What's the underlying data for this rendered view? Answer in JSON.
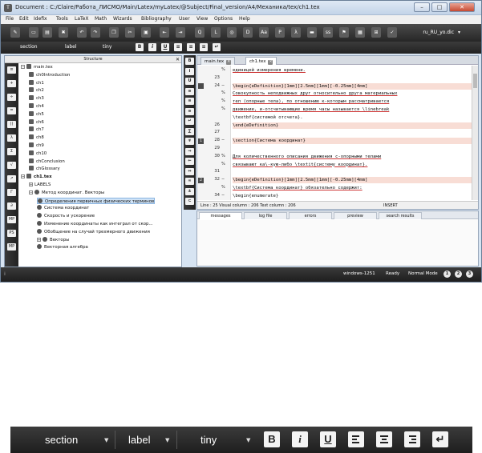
{
  "window": {
    "title": "Document : C:/Claire/Работа_ЛИСМО/Main/Latex/myLatex/@Subject/Final_version/A4/Механика/tex/ch1.tex",
    "min_label": "–",
    "max_label": "□",
    "close_label": "✕"
  },
  "menu": [
    "File",
    "Edit",
    "Idefix",
    "Tools",
    "LaTeX",
    "Math",
    "Wizards",
    "Bibliography",
    "User",
    "View",
    "Options",
    "Help"
  ],
  "toolbar": {
    "dictionary": "ru_RU_yo.dic",
    "icons": [
      "new-file-icon",
      "save-icon",
      "print-icon",
      "close-file-icon",
      "undo-icon",
      "redo-icon",
      "copy-icon",
      "cut-icon",
      "paste-icon",
      "back-icon",
      "forward-icon",
      "find-icon",
      "compile-icon",
      "view-icon",
      "dvi-icon",
      "font-icon",
      "pdf-icon",
      "lambda-icon",
      "ps-icon",
      "table-icon",
      "check-icon"
    ]
  },
  "format_toolbar": {
    "section": "section",
    "label": "label",
    "size": "tiny",
    "bold": "B",
    "italic": "i",
    "underline": "U",
    "align_left": "",
    "align_center": "",
    "align_right": "",
    "newline": "↵"
  },
  "structure": {
    "header": "Structure",
    "close": "✕",
    "tree": [
      {
        "label": "main.tex",
        "level": 0,
        "icon": "doc",
        "expander": "−"
      },
      {
        "label": "ch0Introduction",
        "level": 1,
        "icon": "doc"
      },
      {
        "label": "ch1",
        "level": 1,
        "icon": "doc"
      },
      {
        "label": "ch2",
        "level": 1,
        "icon": "doc"
      },
      {
        "label": "ch3",
        "level": 1,
        "icon": "doc"
      },
      {
        "label": "ch4",
        "level": 1,
        "icon": "doc"
      },
      {
        "label": "ch5",
        "level": 1,
        "icon": "doc"
      },
      {
        "label": "ch6",
        "level": 1,
        "icon": "doc"
      },
      {
        "label": "ch7",
        "level": 1,
        "icon": "doc"
      },
      {
        "label": "ch8",
        "level": 1,
        "icon": "doc"
      },
      {
        "label": "ch9",
        "level": 1,
        "icon": "doc"
      },
      {
        "label": "ch10",
        "level": 1,
        "icon": "doc"
      },
      {
        "label": "chConclusion",
        "level": 1,
        "icon": "doc"
      },
      {
        "label": "chGlossary",
        "level": 1,
        "icon": "doc"
      },
      {
        "label": "ch1.tex",
        "level": 0,
        "icon": "doc",
        "expander": "−",
        "bold": true
      },
      {
        "label": "LABELS",
        "level": 1,
        "icon": "none",
        "expander": "+"
      },
      {
        "label": "Метод координат. Векторы",
        "level": 1,
        "icon": "section",
        "expander": "−"
      },
      {
        "label": "Определения первичных физических терминов",
        "level": 2,
        "icon": "section",
        "selected": true
      },
      {
        "label": "Система координат",
        "level": 2,
        "icon": "section"
      },
      {
        "label": "Скорость и ускорение",
        "level": 2,
        "icon": "section"
      },
      {
        "label": "Изменение координаты как интеграл от скор...",
        "level": 2,
        "icon": "section"
      },
      {
        "label": "Обобщение на случай трехмерного движения",
        "level": 2,
        "icon": "section"
      },
      {
        "label": "Векторы",
        "level": 2,
        "icon": "section",
        "expander": "+"
      },
      {
        "label": "Векторная алгебра",
        "level": 2,
        "icon": "section"
      }
    ],
    "side_icons": [
      "≡",
      "+",
      "÷",
      "=",
      "()",
      "λ",
      "Σ",
      "√",
      "↗",
      "Γ",
      "∂",
      "MP",
      "PS",
      "MP"
    ]
  },
  "editor": {
    "tabs": [
      "main.tex",
      "ch1.tex"
    ],
    "active_tab": "ch1.tex",
    "lines": [
      {
        "num": "",
        "text": "единицей измерения времени.",
        "und": true
      },
      {
        "num": "23",
        "text": ""
      },
      {
        "num": "24",
        "text": "\\begin{eDefinition}[1mm][2.5mm][1mm][-0.25mm][4mm]",
        "hl": true,
        "bm": "",
        "fold": "−"
      },
      {
        "num": "",
        "text": "Совокупность неподвижных друг относительно друга материальных",
        "und": true
      },
      {
        "num": "",
        "text": "тел (опорные тела), по отношению к-которым рассматривается",
        "und": true
      },
      {
        "num": "",
        "text": "движение, и-отсчитывающие время часы называется \\linebreak",
        "und": true
      },
      {
        "num": "",
        "text": "\\textbf{системой отсчета}."
      },
      {
        "num": "26",
        "text": "\\end{eDefinition}",
        "hl": true
      },
      {
        "num": "27",
        "text": ""
      },
      {
        "num": "28",
        "text": "\\section{Система координат}",
        "hl": true,
        "bm": "1",
        "fold": "−"
      },
      {
        "num": "29",
        "text": ""
      },
      {
        "num": "30",
        "text": "Для количественного описания движения с-опорными телами",
        "und": true
      },
      {
        "num": "",
        "text": "связывают ка\\-кую-либо \\textit{систему координат}.",
        "und": true
      },
      {
        "num": "31",
        "text": ""
      },
      {
        "num": "32",
        "text": "\\begin{eDefinition}[1mm][2.5mm][1mm][-0.25mm][4mm]",
        "hl": true,
        "bm": "2",
        "fold": "−"
      },
      {
        "num": "",
        "text": "\\textbf{Система координат} обязательно содержит:",
        "und": true
      },
      {
        "num": "34",
        "text": "\\begin{enumerate}",
        "fold": "−"
      }
    ],
    "gutter_marks": [
      "%",
      "",
      "",
      "%",
      "%",
      "%",
      "",
      "",
      "",
      "",
      "",
      "%",
      "%",
      "",
      "",
      "%",
      ""
    ],
    "status": {
      "line_col": "Line : 25 Visual column : 206 Text column : 206",
      "mode": "INSERT"
    },
    "side_icons": [
      "B",
      "i",
      "U",
      "≡",
      "≡",
      "≡",
      "↵",
      "∑",
      "∓",
      "⇒",
      "⇐",
      "⇔",
      "≈",
      "±",
      "⊂"
    ]
  },
  "messages": {
    "tabs": [
      "messages",
      "log file",
      "errors",
      "preview",
      "search results"
    ],
    "active_tab": "messages"
  },
  "statusbar": {
    "encoding": "windows-1251",
    "ready": "Ready",
    "mode": "Normal Mode",
    "nums": [
      "1",
      "2",
      "3"
    ],
    "grip": "⁞"
  },
  "colors": {
    "toolbar_bg": "#2a2a2a",
    "highlight_line": "#f8ddd5",
    "selected_tree": "#cfe3f7",
    "window_frame": "#d7e4f2"
  }
}
